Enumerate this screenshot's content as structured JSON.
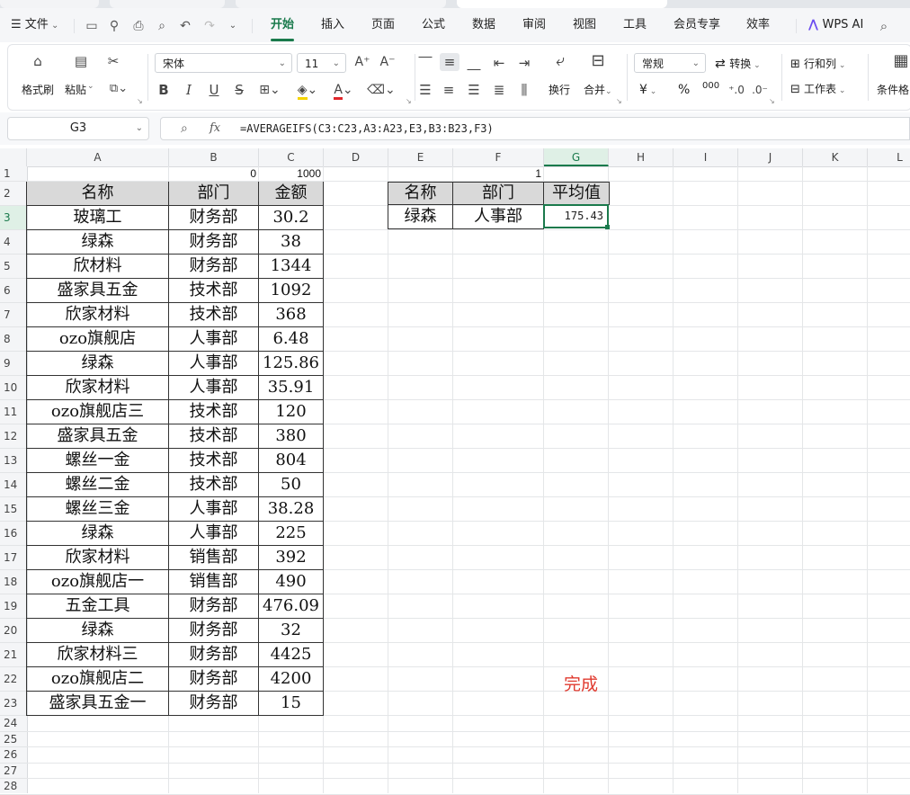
{
  "menu": {
    "file_label": "文件",
    "tabs": [
      "开始",
      "插入",
      "页面",
      "公式",
      "数据",
      "审阅",
      "视图",
      "工具",
      "会员专享",
      "效率"
    ],
    "active_tab": "开始",
    "wps_ai_label": "WPS AI"
  },
  "ribbon": {
    "format_painter": "格式刷",
    "paste": "粘贴",
    "font_name": "宋体",
    "font_size": "11",
    "wrap": "换行",
    "merge": "合并",
    "number_format": "常规",
    "convert": "转换",
    "rows_cols": "行和列",
    "worksheet": "工作表",
    "conditional": "条件格",
    "currency_symbol": "¥",
    "percent_symbol": "%",
    "thousand_symbol": "000"
  },
  "formula_bar": {
    "name_box": "G3",
    "fx": "fx",
    "formula": "=AVERAGEIFS(C3:C23,A3:A23,E3,B3:B23,F3)"
  },
  "columns": [
    "A",
    "B",
    "C",
    "D",
    "E",
    "F",
    "G",
    "H",
    "I",
    "J",
    "K",
    "L"
  ],
  "rows": [
    "1",
    "2",
    "3",
    "4",
    "5",
    "6",
    "7",
    "8",
    "9",
    "10",
    "11",
    "12",
    "13",
    "14",
    "15",
    "16",
    "17",
    "18",
    "19",
    "20",
    "21",
    "22",
    "23",
    "24",
    "25",
    "26",
    "27",
    "28"
  ],
  "row1": {
    "b1": "0",
    "c1": "1000",
    "f1": "1"
  },
  "table": {
    "headers": [
      "名称",
      "部门",
      "金额"
    ],
    "rows": [
      [
        "玻璃工",
        "财务部",
        "30.2"
      ],
      [
        "绿森",
        "财务部",
        "38"
      ],
      [
        "欣材料",
        "财务部",
        "1344"
      ],
      [
        "盛家具五金",
        "技术部",
        "1092"
      ],
      [
        "欣家材料",
        "技术部",
        "368"
      ],
      [
        "ozo旗舰店",
        "人事部",
        "6.48"
      ],
      [
        "绿森",
        "人事部",
        "125.86"
      ],
      [
        "欣家材料",
        "人事部",
        "35.91"
      ],
      [
        "ozo旗舰店三",
        "技术部",
        "120"
      ],
      [
        "盛家具五金",
        "技术部",
        "380"
      ],
      [
        "螺丝一金",
        "技术部",
        "804"
      ],
      [
        "螺丝二金",
        "技术部",
        "50"
      ],
      [
        "螺丝三金",
        "人事部",
        "38.28"
      ],
      [
        "绿森",
        "人事部",
        "225"
      ],
      [
        "欣家材料",
        "销售部",
        "392"
      ],
      [
        "ozo旗舰店一",
        "销售部",
        "490"
      ],
      [
        "五金工具",
        "财务部",
        "476.09"
      ],
      [
        "绿森",
        "财务部",
        "32"
      ],
      [
        "欣家材料三",
        "财务部",
        "4425"
      ],
      [
        "ozo旗舰店二",
        "财务部",
        "4200"
      ],
      [
        "盛家具五金一",
        "财务部",
        "15"
      ]
    ]
  },
  "criteria": {
    "headers": [
      "名称",
      "部门",
      "平均值"
    ],
    "name": "绿森",
    "dept": "人事部",
    "result": "175.43"
  },
  "status_text": "完成",
  "colors": {
    "accent": "#1a7a4c",
    "header_fill": "#d9d9d9",
    "status_red": "#e03a2f"
  }
}
